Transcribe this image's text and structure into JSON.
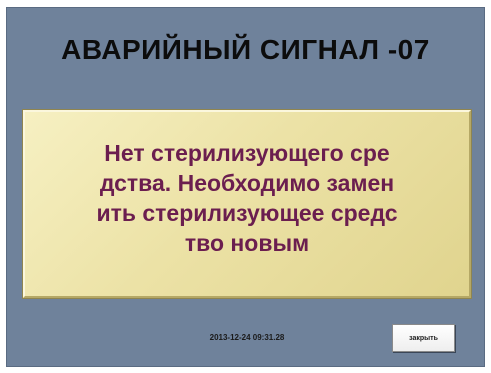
{
  "alarm": {
    "title": "АВАРИЙНЫЙ СИГНАЛ -07",
    "message_lines": [
      "Нет стерилизующего сре",
      "дства. Необходимо замен",
      "ить стерилизующее средс",
      "тво новым"
    ],
    "timestamp": "2013-12-24  09:31.28",
    "close_label": "закрыть"
  },
  "colors": {
    "background": "#6f829b",
    "message_panel": "#ece2a6",
    "message_text": "#6b1e4f",
    "title_text": "#0c0c0c"
  }
}
